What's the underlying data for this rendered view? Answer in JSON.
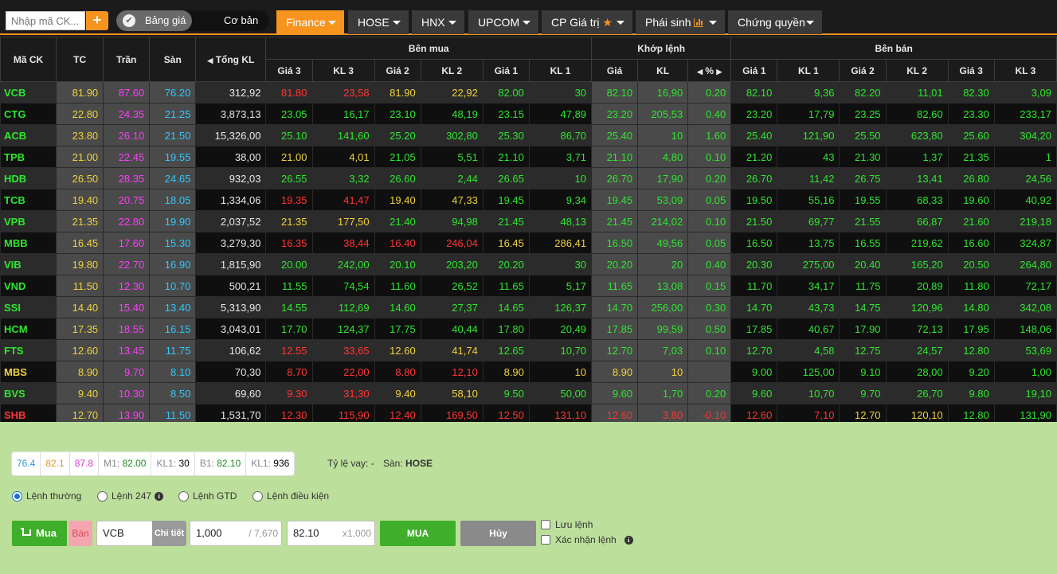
{
  "topbar": {
    "search_placeholder": "Nhập mã CK...",
    "add_label": "+",
    "toggle_on": "Bảng giá",
    "toggle_off": "Cơ bản",
    "tabs": [
      {
        "label": "Finance",
        "active": true
      },
      {
        "label": "HOSE"
      },
      {
        "label": "HNX"
      },
      {
        "label": "UPCOM"
      },
      {
        "label": "CP Giá trị"
      },
      {
        "label": "Phái sinh"
      },
      {
        "label": "Chứng quyền"
      }
    ]
  },
  "board": {
    "headers": {
      "symbol": "Mã CK",
      "ref": "TC",
      "ceil": "Trần",
      "floor": "Sàn",
      "total_vol": "Tổng KL",
      "buy_group": "Bên mua",
      "match_group": "Khớp lệnh",
      "sell_group": "Bên bán",
      "buy_cols": [
        "Giá 3",
        "KL 3",
        "Giá 2",
        "KL 2",
        "Giá 1",
        "KL 1"
      ],
      "match_cols": [
        "Giá",
        "KL",
        "%"
      ],
      "sell_cols": [
        "Giá 1",
        "KL 1",
        "Giá 2",
        "KL 2",
        "Giá 3",
        "KL 3"
      ]
    },
    "rows": [
      {
        "sym": "VCB",
        "tc": "81.90",
        "tran": "87.60",
        "san": "76.20",
        "tkl": "312,92",
        "b3": "81.80",
        "bv3": "23,58",
        "b2": "81.90",
        "bv2": "22,92",
        "b1": "82.00",
        "bv1": "30",
        "mp": "82.10",
        "mv": "16,90",
        "pct": "0.20",
        "s1": "82.10",
        "sv1": "9,36",
        "s2": "82.20",
        "sv2": "11,01",
        "s3": "82.30",
        "sv3": "3,09",
        "c": {
          "sym": "g",
          "b3": "r",
          "b2": "y",
          "b1": "g",
          "m": "g",
          "s1": "g",
          "s2": "g",
          "s3": "g"
        }
      },
      {
        "sym": "CTG",
        "tc": "22.80",
        "tran": "24.35",
        "san": "21.25",
        "tkl": "3,873,13",
        "b3": "23.05",
        "bv3": "16,17",
        "b2": "23.10",
        "bv2": "48,19",
        "b1": "23.15",
        "bv1": "47,89",
        "mp": "23.20",
        "mv": "205,53",
        "pct": "0.40",
        "s1": "23.20",
        "sv1": "17,79",
        "s2": "23.25",
        "sv2": "82,60",
        "s3": "23.30",
        "sv3": "233,17",
        "c": {
          "sym": "g",
          "b3": "g",
          "b2": "g",
          "b1": "g",
          "m": "g",
          "s1": "g",
          "s2": "g",
          "s3": "g"
        }
      },
      {
        "sym": "ACB",
        "tc": "23.80",
        "tran": "26.10",
        "san": "21.50",
        "tkl": "15,326,00",
        "b3": "25.10",
        "bv3": "141,60",
        "b2": "25.20",
        "bv2": "302,80",
        "b1": "25.30",
        "bv1": "86,70",
        "mp": "25.40",
        "mv": "10",
        "pct": "1.60",
        "s1": "25.40",
        "sv1": "121,90",
        "s2": "25.50",
        "sv2": "623,80",
        "s3": "25.60",
        "sv3": "304,20",
        "c": {
          "sym": "g",
          "b3": "g",
          "b2": "g",
          "b1": "g",
          "m": "g",
          "s1": "g",
          "s2": "g",
          "s3": "g"
        }
      },
      {
        "sym": "TPB",
        "tc": "21.00",
        "tran": "22.45",
        "san": "19.55",
        "tkl": "38,00",
        "b3": "21.00",
        "bv3": "4,01",
        "b2": "21.05",
        "bv2": "5,51",
        "b1": "21.10",
        "bv1": "3,71",
        "mp": "21.10",
        "mv": "4,80",
        "pct": "0.10",
        "s1": "21.20",
        "sv1": "43",
        "s2": "21.30",
        "sv2": "1,37",
        "s3": "21.35",
        "sv3": "1",
        "c": {
          "sym": "g",
          "b3": "y",
          "b2": "g",
          "b1": "g",
          "m": "g",
          "s1": "g",
          "s2": "g",
          "s3": "g"
        }
      },
      {
        "sym": "HDB",
        "tc": "26.50",
        "tran": "28.35",
        "san": "24.65",
        "tkl": "932,03",
        "b3": "26.55",
        "bv3": "3,32",
        "b2": "26.60",
        "bv2": "2,44",
        "b1": "26.65",
        "bv1": "10",
        "mp": "26.70",
        "mv": "17,90",
        "pct": "0.20",
        "s1": "26.70",
        "sv1": "11,42",
        "s2": "26.75",
        "sv2": "13,41",
        "s3": "26.80",
        "sv3": "24,56",
        "c": {
          "sym": "g",
          "b3": "g",
          "b2": "g",
          "b1": "g",
          "m": "g",
          "s1": "g",
          "s2": "g",
          "s3": "g"
        }
      },
      {
        "sym": "TCB",
        "tc": "19.40",
        "tran": "20.75",
        "san": "18.05",
        "tkl": "1,334,06",
        "b3": "19.35",
        "bv3": "41,47",
        "b2": "19.40",
        "bv2": "47,33",
        "b1": "19.45",
        "bv1": "9,34",
        "mp": "19.45",
        "mv": "53,09",
        "pct": "0.05",
        "s1": "19.50",
        "sv1": "55,16",
        "s2": "19.55",
        "sv2": "68,33",
        "s3": "19.60",
        "sv3": "40,92",
        "c": {
          "sym": "g",
          "b3": "r",
          "b2": "y",
          "b1": "g",
          "m": "g",
          "s1": "g",
          "s2": "g",
          "s3": "g"
        }
      },
      {
        "sym": "VPB",
        "tc": "21.35",
        "tran": "22.80",
        "san": "19.90",
        "tkl": "2,037,52",
        "b3": "21.35",
        "bv3": "177,50",
        "b2": "21.40",
        "bv2": "94,98",
        "b1": "21.45",
        "bv1": "48,13",
        "mp": "21.45",
        "mv": "214,02",
        "pct": "0.10",
        "s1": "21.50",
        "sv1": "69,77",
        "s2": "21.55",
        "sv2": "66,87",
        "s3": "21.60",
        "sv3": "219,18",
        "c": {
          "sym": "g",
          "b3": "y",
          "b2": "g",
          "b1": "g",
          "m": "g",
          "s1": "g",
          "s2": "g",
          "s3": "g"
        }
      },
      {
        "sym": "MBB",
        "tc": "16.45",
        "tran": "17.60",
        "san": "15.30",
        "tkl": "3,279,30",
        "b3": "16.35",
        "bv3": "38,44",
        "b2": "16.40",
        "bv2": "246,04",
        "b1": "16.45",
        "bv1": "286,41",
        "mp": "16.50",
        "mv": "49,56",
        "pct": "0.05",
        "s1": "16.50",
        "sv1": "13,75",
        "s2": "16.55",
        "sv2": "219,62",
        "s3": "16.60",
        "sv3": "324,87",
        "c": {
          "sym": "g",
          "b3": "r",
          "b2": "r",
          "b1": "y",
          "m": "g",
          "s1": "g",
          "s2": "g",
          "s3": "g"
        }
      },
      {
        "sym": "VIB",
        "tc": "19.80",
        "tran": "22.70",
        "san": "16.90",
        "tkl": "1,815,90",
        "b3": "20.00",
        "bv3": "242,00",
        "b2": "20.10",
        "bv2": "203,20",
        "b1": "20.20",
        "bv1": "30",
        "mp": "20.20",
        "mv": "20",
        "pct": "0.40",
        "s1": "20.30",
        "sv1": "275,00",
        "s2": "20.40",
        "sv2": "165,20",
        "s3": "20.50",
        "sv3": "264,80",
        "c": {
          "sym": "g",
          "b3": "g",
          "b2": "g",
          "b1": "g",
          "m": "g",
          "s1": "g",
          "s2": "g",
          "s3": "g"
        }
      },
      {
        "sym": "VND",
        "tc": "11.50",
        "tran": "12.30",
        "san": "10.70",
        "tkl": "500,21",
        "b3": "11.55",
        "bv3": "74,54",
        "b2": "11.60",
        "bv2": "26,52",
        "b1": "11.65",
        "bv1": "5,17",
        "mp": "11.65",
        "mv": "13,08",
        "pct": "0.15",
        "s1": "11.70",
        "sv1": "34,17",
        "s2": "11.75",
        "sv2": "20,89",
        "s3": "11.80",
        "sv3": "72,17",
        "c": {
          "sym": "g",
          "b3": "g",
          "b2": "g",
          "b1": "g",
          "m": "g",
          "s1": "g",
          "s2": "g",
          "s3": "g"
        }
      },
      {
        "sym": "SSI",
        "tc": "14.40",
        "tran": "15.40",
        "san": "13.40",
        "tkl": "5,313,90",
        "b3": "14.55",
        "bv3": "112,69",
        "b2": "14.60",
        "bv2": "27,37",
        "b1": "14.65",
        "bv1": "126,37",
        "mp": "14.70",
        "mv": "256,00",
        "pct": "0.30",
        "s1": "14.70",
        "sv1": "43,73",
        "s2": "14.75",
        "sv2": "120,96",
        "s3": "14.80",
        "sv3": "342,08",
        "c": {
          "sym": "g",
          "b3": "g",
          "b2": "g",
          "b1": "g",
          "m": "g",
          "s1": "g",
          "s2": "g",
          "s3": "g"
        }
      },
      {
        "sym": "HCM",
        "tc": "17.35",
        "tran": "18.55",
        "san": "16.15",
        "tkl": "3,043,01",
        "b3": "17.70",
        "bv3": "124,37",
        "b2": "17.75",
        "bv2": "40,44",
        "b1": "17.80",
        "bv1": "20,49",
        "mp": "17.85",
        "mv": "99,59",
        "pct": "0.50",
        "s1": "17.85",
        "sv1": "40,67",
        "s2": "17.90",
        "sv2": "72,13",
        "s3": "17.95",
        "sv3": "148,06",
        "c": {
          "sym": "g",
          "b3": "g",
          "b2": "g",
          "b1": "g",
          "m": "g",
          "s1": "g",
          "s2": "g",
          "s3": "g"
        }
      },
      {
        "sym": "FTS",
        "tc": "12.60",
        "tran": "13.45",
        "san": "11.75",
        "tkl": "106,62",
        "b3": "12.55",
        "bv3": "33,65",
        "b2": "12.60",
        "bv2": "41,74",
        "b1": "12.65",
        "bv1": "10,70",
        "mp": "12.70",
        "mv": "7,03",
        "pct": "0.10",
        "s1": "12.70",
        "sv1": "4,58",
        "s2": "12.75",
        "sv2": "24,57",
        "s3": "12.80",
        "sv3": "53,69",
        "c": {
          "sym": "g",
          "b3": "r",
          "b2": "y",
          "b1": "g",
          "m": "g",
          "s1": "g",
          "s2": "g",
          "s3": "g"
        }
      },
      {
        "sym": "MBS",
        "tc": "8.90",
        "tran": "9.70",
        "san": "8.10",
        "tkl": "70,30",
        "b3": "8.70",
        "bv3": "22,00",
        "b2": "8.80",
        "bv2": "12,10",
        "b1": "8.90",
        "bv1": "10",
        "mp": "8.90",
        "mv": "10",
        "pct": "",
        "s1": "9.00",
        "sv1": "125,00",
        "s2": "9.10",
        "sv2": "28,00",
        "s3": "9.20",
        "sv3": "1,00",
        "c": {
          "sym": "y",
          "b3": "r",
          "b2": "r",
          "b1": "y",
          "m": "y",
          "s1": "g",
          "s2": "g",
          "s3": "g"
        }
      },
      {
        "sym": "BVS",
        "tc": "9.40",
        "tran": "10.30",
        "san": "8.50",
        "tkl": "69,60",
        "b3": "9.30",
        "bv3": "31,30",
        "b2": "9.40",
        "bv2": "58,10",
        "b1": "9.50",
        "bv1": "50,00",
        "mp": "9.60",
        "mv": "1,70",
        "pct": "0.20",
        "s1": "9.60",
        "sv1": "10,70",
        "s2": "9.70",
        "sv2": "26,70",
        "s3": "9.80",
        "sv3": "19,10",
        "c": {
          "sym": "g",
          "b3": "r",
          "b2": "y",
          "b1": "g",
          "m": "g",
          "s1": "g",
          "s2": "g",
          "s3": "g"
        }
      },
      {
        "sym": "SHB",
        "tc": "12.70",
        "tran": "13.90",
        "san": "11.50",
        "tkl": "1,531,70",
        "b3": "12.30",
        "bv3": "115,90",
        "b2": "12.40",
        "bv2": "169,50",
        "b1": "12.50",
        "bv1": "131,10",
        "mp": "12.60",
        "mv": "3,80",
        "pct": "-0.10",
        "s1": "12.60",
        "sv1": "7,10",
        "s2": "12.70",
        "sv2": "120,10",
        "s3": "12.80",
        "sv3": "131,90",
        "c": {
          "sym": "r",
          "b3": "r",
          "b2": "r",
          "b1": "r",
          "m": "r",
          "s1": "r",
          "s2": "y",
          "s3": "g"
        }
      }
    ]
  },
  "order": {
    "quote": {
      "floor": "76.4",
      "ref": "82.1",
      "ceil": "87.8",
      "m1_label": "M1:",
      "m1": "82.00",
      "kl1_label": "KL1:",
      "kl1": "30",
      "b1_label": "B1:",
      "b1": "82.10",
      "kl1b_label": "KL1:",
      "kl1b": "936"
    },
    "loan_label": "Tỷ lệ vay:",
    "loan_value": "-",
    "exchange_label": "Sàn:",
    "exchange_value": "HOSE",
    "order_types": [
      {
        "label": "Lệnh thường",
        "checked": true
      },
      {
        "label": "Lệnh 247",
        "info": true
      },
      {
        "label": "Lệnh GTD"
      },
      {
        "label": "Lệnh điều kiện"
      }
    ],
    "buy_tab": "Mua",
    "sell_tab": "Bán",
    "symbol": "VCB",
    "detail_btn": "Chi tiết",
    "qty": "1,000",
    "qty_max": "/ 7,670",
    "price": "82.10",
    "price_unit": "x1,000",
    "submit": "MUA",
    "cancel": "Hủy",
    "save_order": "Lưu lệnh",
    "confirm_order": "Xác nhận lệnh"
  },
  "colors": {
    "up": "#2ee62e",
    "down": "#ff3535",
    "ref": "#f0d23c",
    "ceil": "#ff3cff",
    "floor": "#2ec8ff",
    "accent": "#f7941d",
    "panel": "#bce09c"
  }
}
